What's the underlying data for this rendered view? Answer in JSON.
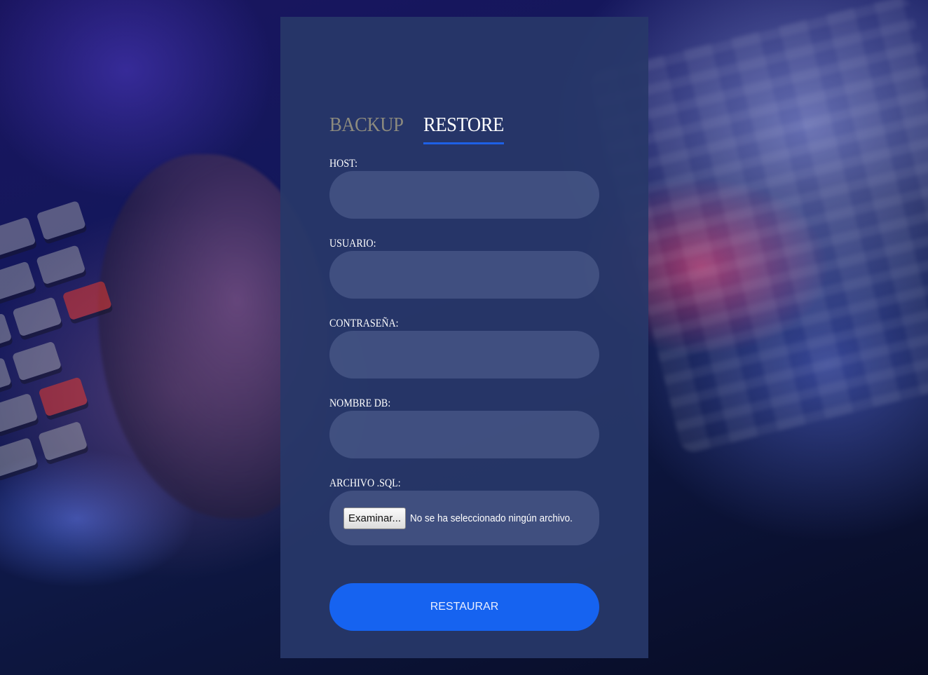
{
  "tabs": [
    {
      "label": "BACKUP",
      "active": false
    },
    {
      "label": "RESTORE",
      "active": true
    }
  ],
  "form": {
    "host_label": "HOST:",
    "host_value": "",
    "user_label": "USUARIO:",
    "user_value": "",
    "password_label": "CONTRASEÑA:",
    "password_value": "",
    "dbname_label": "NOMBRE DB:",
    "dbname_value": "",
    "file_label": "ARCHIVO .SQL:",
    "file_button": "Examinar...",
    "file_status": "No se ha seleccionado ningún archivo.",
    "submit_label": "RESTAURAR"
  },
  "colors": {
    "accent": "#1663f0",
    "tab_underline": "#1e60e6",
    "inactive_tab": "#8c8a7e",
    "panel": "#283869"
  }
}
